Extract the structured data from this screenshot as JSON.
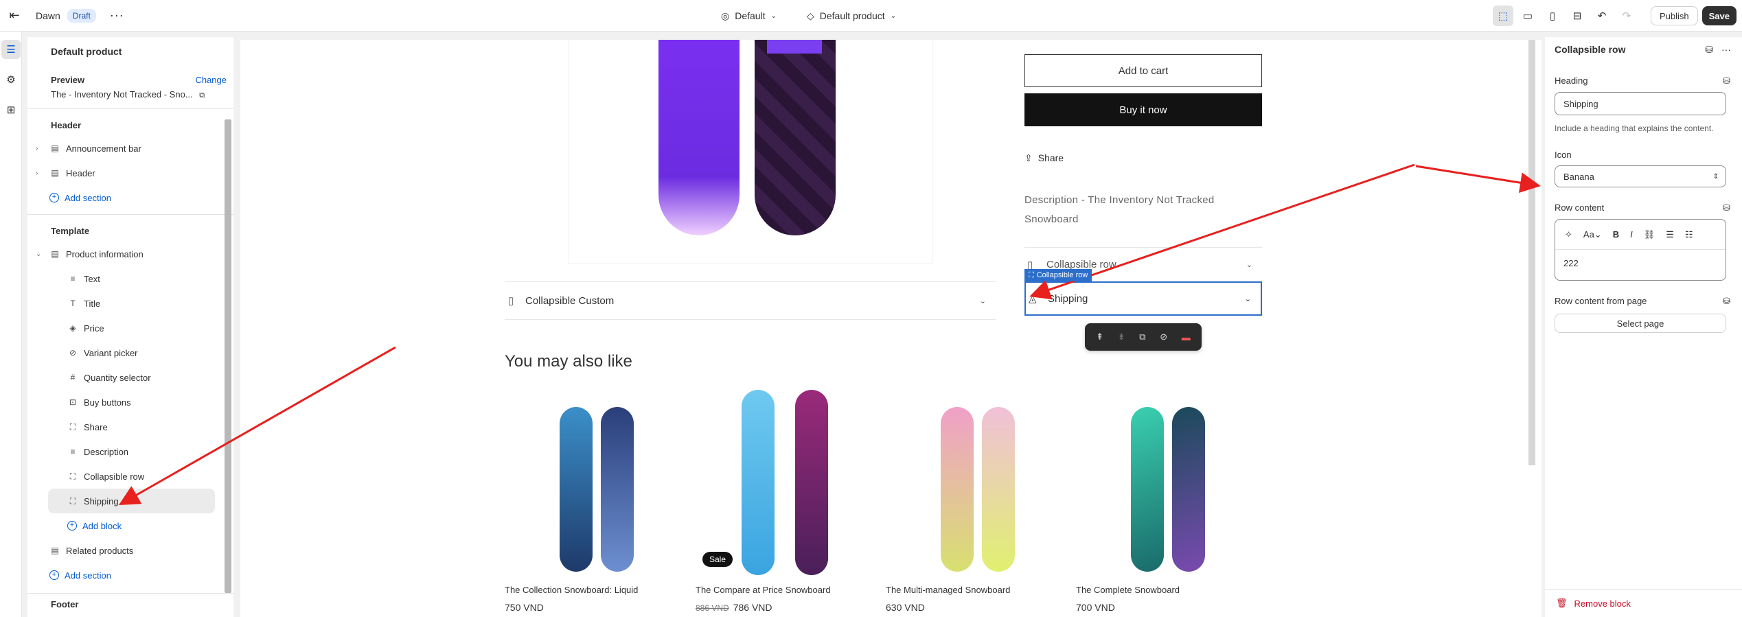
{
  "topbar": {
    "theme_name": "Dawn",
    "status_badge": "Draft",
    "theme_selector": "Default",
    "template_selector": "Default product",
    "publish_label": "Publish",
    "save_label": "Save"
  },
  "sidebar": {
    "title": "Default product",
    "preview_label": "Preview",
    "change_label": "Change",
    "preview_value": "The - Inventory Not Tracked - Sno...",
    "header_group": "Header",
    "header_items": [
      {
        "label": "Announcement bar"
      },
      {
        "label": "Header"
      }
    ],
    "add_section_label": "Add section",
    "template_group": "Template",
    "product_information": "Product information",
    "blocks": [
      {
        "label": "Text",
        "icon": "text-icon"
      },
      {
        "label": "Title",
        "icon": "title-icon"
      },
      {
        "label": "Price",
        "icon": "price-icon"
      },
      {
        "label": "Variant picker",
        "icon": "variant-icon"
      },
      {
        "label": "Quantity selector",
        "icon": "hash-icon"
      },
      {
        "label": "Buy buttons",
        "icon": "buy-icon"
      },
      {
        "label": "Share",
        "icon": "block-icon"
      },
      {
        "label": "Description",
        "icon": "description-icon"
      },
      {
        "label": "Collapsible row",
        "icon": "block-icon"
      },
      {
        "label": "Shipping",
        "icon": "block-icon"
      }
    ],
    "add_block_label": "Add block",
    "related_products": "Related products",
    "footer_group": "Footer"
  },
  "canvas": {
    "add_to_cart": "Add to cart",
    "buy_it_now": "Buy it now",
    "share": "Share",
    "description": "Description - The Inventory Not Tracked Snowboard",
    "collapsible_custom": "Collapsible Custom",
    "collapsible_row": "Collapsible row",
    "selection_tag": "Collapsible row",
    "shipping_row": "Shipping",
    "also_like": "You may also like",
    "products": [
      {
        "title": "The Collection Snowboard: Liquid",
        "price": "750 VND",
        "old_price": ""
      },
      {
        "title": "The Compare at Price Snowboard",
        "price": "786 VND",
        "old_price": "886 VND",
        "badge": "Sale"
      },
      {
        "title": "The Multi-managed Snowboard",
        "price": "630 VND",
        "old_price": ""
      },
      {
        "title": "The Complete Snowboard",
        "price": "700 VND",
        "old_price": ""
      }
    ]
  },
  "panel": {
    "title": "Collapsible row",
    "heading_label": "Heading",
    "heading_value": "Shipping",
    "heading_help": "Include a heading that explains the content.",
    "icon_label": "Icon",
    "icon_value": "Banana",
    "row_content_label": "Row content",
    "row_content_value": "222",
    "row_content_page_label": "Row content from page",
    "select_page_label": "Select page",
    "remove_block_label": "Remove block"
  },
  "colors": {
    "accent": "#005bd3",
    "selection": "#2c6ecb",
    "annotation_arrow": "#e8201e",
    "danger": "#c70a24"
  }
}
